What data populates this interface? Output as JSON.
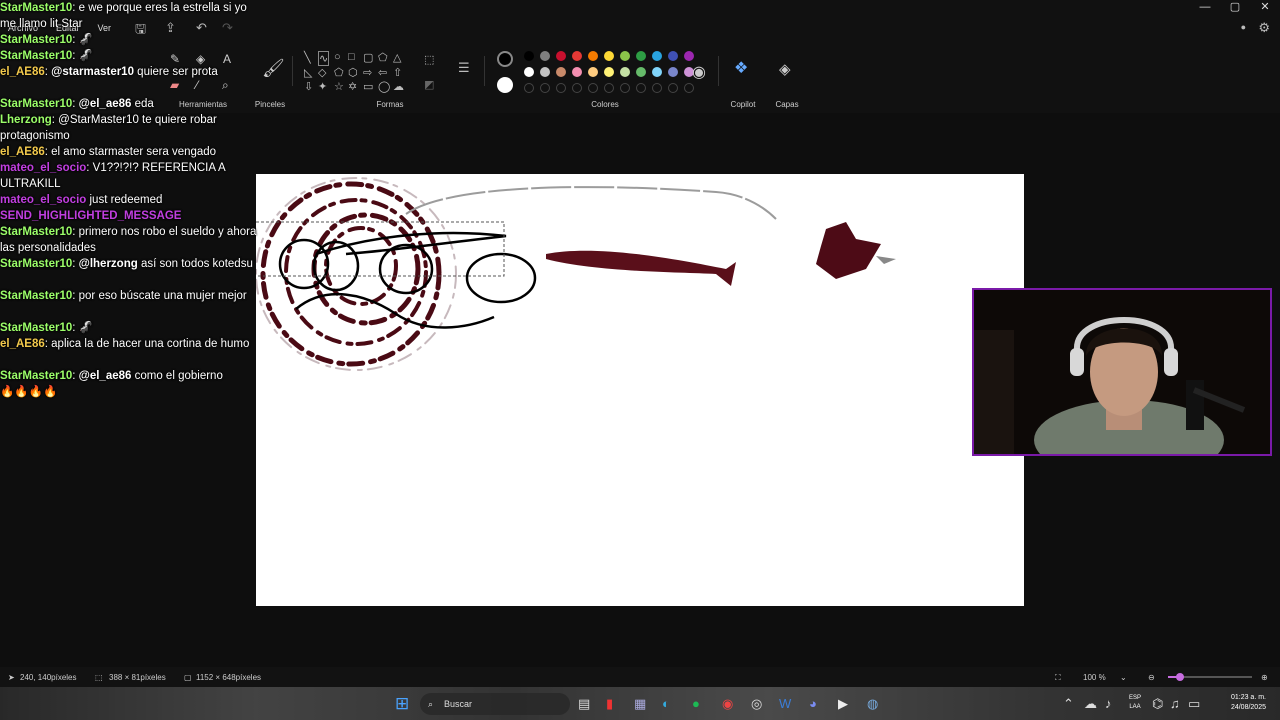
{
  "window": {
    "controls": [
      "—",
      "▢",
      "✕"
    ]
  },
  "menu": [
    "Archivo",
    "Editar",
    "Ver"
  ],
  "ribbon": {
    "groups": {
      "tools": "Herramientas",
      "brushes": "Pinceles",
      "shapes": "Formas",
      "colors": "Colores",
      "copilot": "Copilot",
      "layers": "Capas"
    },
    "primary_color": "#000000",
    "secondary_color": "#ffffff",
    "palette_row1": [
      "#000000",
      "#7f7f7f",
      "#c8102e",
      "#e53935",
      "#f57c00",
      "#fdd835",
      "#8bc34a",
      "#2e9e44",
      "#29a3e0",
      "#3f51b5",
      "#9c27b0"
    ],
    "palette_row2": [
      "#ffffff",
      "#c3c3c3",
      "#c98a6a",
      "#f48fb1",
      "#ffcc80",
      "#fff176",
      "#c5e1a5",
      "#66bb6a",
      "#81d4fa",
      "#7986cb",
      "#ce93d8"
    ]
  },
  "chat": [
    {
      "user": "StarMaster10",
      "user_color": "#9cff6a",
      "text": ": e we porque eres la estrella si yo me llamo lit Star"
    },
    {
      "user": "StarMaster10",
      "user_color": "#9cff6a",
      "text": ": 🦨"
    },
    {
      "user": "StarMaster10",
      "user_color": "#9cff6a",
      "text": ": 🦨"
    },
    {
      "user": "el_AE86",
      "user_color": "#f2c94c",
      "mention": "@starmaster10",
      "text": " quiere ser prota"
    },
    {
      "user": "StarMaster10",
      "user_color": "#9cff6a",
      "mention": "@el_ae86",
      "text": " eda"
    },
    {
      "user": "Lherzong",
      "user_color": "#9cff6a",
      "text": ": @StarMaster10 te quiere robar protagonismo"
    },
    {
      "user": "el_AE86",
      "user_color": "#f2c94c",
      "text": ": el amo starmaster sera vengado"
    },
    {
      "user": "mateo_el_socio",
      "user_color": "#c13fe0",
      "text": ": V1??!?!? REFERENCIA A ULTRAKILL"
    },
    {
      "user": "mateo_el_socio",
      "user_color": "#c13fe0",
      "text": " just redeemed"
    },
    {
      "user": "SEND_HIGHLIGHTED_MESSAGE",
      "user_color": "#c13fe0",
      "text": ""
    },
    {
      "user": "StarMaster10",
      "user_color": "#9cff6a",
      "text": ": primero nos robo el sueldo y ahora las personalidades"
    },
    {
      "user": "StarMaster10",
      "user_color": "#9cff6a",
      "mention": "@lherzong",
      "text": " así son todos kotedsu"
    },
    {
      "user": "StarMaster10",
      "user_color": "#9cff6a",
      "text": ": por eso búscate una mujer mejor"
    },
    {
      "user": "StarMaster10",
      "user_color": "#9cff6a",
      "text": ": 🦨"
    },
    {
      "user": "el_AE86",
      "user_color": "#f2c94c",
      "text": ": aplica la de hacer una cortina de humo"
    },
    {
      "user": "StarMaster10",
      "user_color": "#9cff6a",
      "mention": "@el_ae86",
      "text": " como el gobierno"
    },
    {
      "user": "",
      "user_color": "#ffffff",
      "text": "🔥🔥🔥🔥"
    }
  ],
  "status": {
    "cursor_pos": "240, 140píxeles",
    "selection_size": "388 × 81píxeles",
    "canvas_size": "1152 × 648píxeles",
    "zoom": "100 %",
    "zoom_fraction": 0.14
  },
  "taskbar": {
    "search_placeholder": "Buscar",
    "lang_top": "ESP",
    "lang_bottom": "LAA",
    "time": "01:23 a. m.",
    "date": "24/08/2025"
  }
}
